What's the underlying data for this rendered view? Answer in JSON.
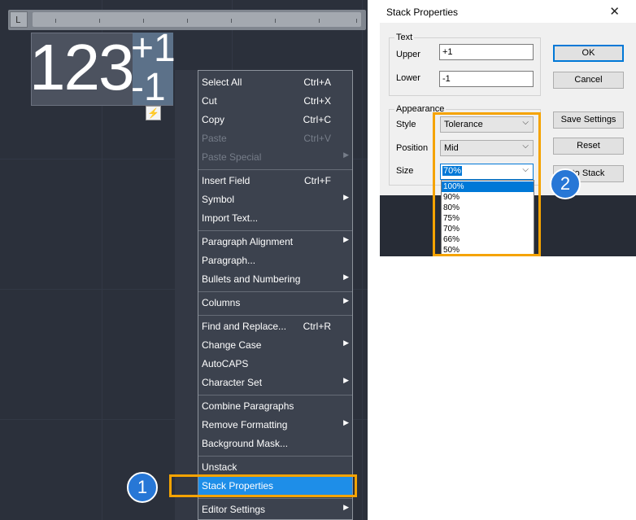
{
  "editor": {
    "mtext_main": "123",
    "stack_upper": "+1",
    "stack_lower": "-1",
    "ruler_corner": "L",
    "smart_icon": "⚡"
  },
  "context_menu": {
    "items": [
      {
        "label": "Select All",
        "shortcut": "Ctrl+A",
        "submenu": false,
        "disabled": false
      },
      {
        "label": "Cut",
        "shortcut": "Ctrl+X",
        "submenu": false,
        "disabled": false
      },
      {
        "label": "Copy",
        "shortcut": "Ctrl+C",
        "submenu": false,
        "disabled": false
      },
      {
        "label": "Paste",
        "shortcut": "Ctrl+V",
        "submenu": false,
        "disabled": true
      },
      {
        "label": "Paste Special",
        "shortcut": "",
        "submenu": true,
        "disabled": true
      },
      {
        "label": "Insert Field",
        "shortcut": "Ctrl+F",
        "submenu": false,
        "disabled": false
      },
      {
        "label": "Symbol",
        "shortcut": "",
        "submenu": true,
        "disabled": false
      },
      {
        "label": "Import Text...",
        "shortcut": "",
        "submenu": false,
        "disabled": false
      },
      {
        "label": "Paragraph Alignment",
        "shortcut": "",
        "submenu": true,
        "disabled": false
      },
      {
        "label": "Paragraph...",
        "shortcut": "",
        "submenu": false,
        "disabled": false
      },
      {
        "label": "Bullets and Numbering",
        "shortcut": "",
        "submenu": true,
        "disabled": false
      },
      {
        "label": "Columns",
        "shortcut": "",
        "submenu": true,
        "disabled": false
      },
      {
        "label": "Find and Replace...",
        "shortcut": "Ctrl+R",
        "submenu": false,
        "disabled": false
      },
      {
        "label": "Change Case",
        "shortcut": "",
        "submenu": true,
        "disabled": false
      },
      {
        "label": "AutoCAPS",
        "shortcut": "",
        "submenu": false,
        "disabled": false
      },
      {
        "label": "Character Set",
        "shortcut": "",
        "submenu": true,
        "disabled": false
      },
      {
        "label": "Combine Paragraphs",
        "shortcut": "",
        "submenu": false,
        "disabled": false
      },
      {
        "label": "Remove Formatting",
        "shortcut": "",
        "submenu": true,
        "disabled": false
      },
      {
        "label": "Background Mask...",
        "shortcut": "",
        "submenu": false,
        "disabled": false
      },
      {
        "label": "Unstack",
        "shortcut": "",
        "submenu": false,
        "disabled": false
      },
      {
        "label": "Stack Properties",
        "shortcut": "",
        "submenu": false,
        "disabled": false,
        "selected": true
      },
      {
        "label": "Editor Settings",
        "shortcut": "",
        "submenu": true,
        "disabled": false
      }
    ],
    "arrow_glyph": "▶"
  },
  "callouts": {
    "one": "1",
    "two": "2"
  },
  "dialog": {
    "title": "Stack Properties",
    "close_glyph": "✕",
    "text_group": {
      "label": "Text",
      "upper_label": "Upper",
      "upper_value": "+1",
      "lower_label": "Lower",
      "lower_value": "-1"
    },
    "appearance_group": {
      "label": "Appearance",
      "style_label": "Style",
      "style_value": "Tolerance",
      "position_label": "Position",
      "position_value": "Mid",
      "size_label": "Size",
      "size_value": "70%"
    },
    "buttons": {
      "ok": "OK",
      "cancel": "Cancel",
      "save_settings": "Save Settings",
      "reset": "Reset",
      "autostack": "to Stack"
    },
    "size_options": [
      "100%",
      "90%",
      "80%",
      "75%",
      "70%",
      "66%",
      "50%"
    ],
    "size_selected_option": "100%",
    "chevron_glyph": "⌵"
  },
  "colors": {
    "highlight": "#f5a300",
    "badge": "#2777d6",
    "selection": "#1e8ee8"
  }
}
